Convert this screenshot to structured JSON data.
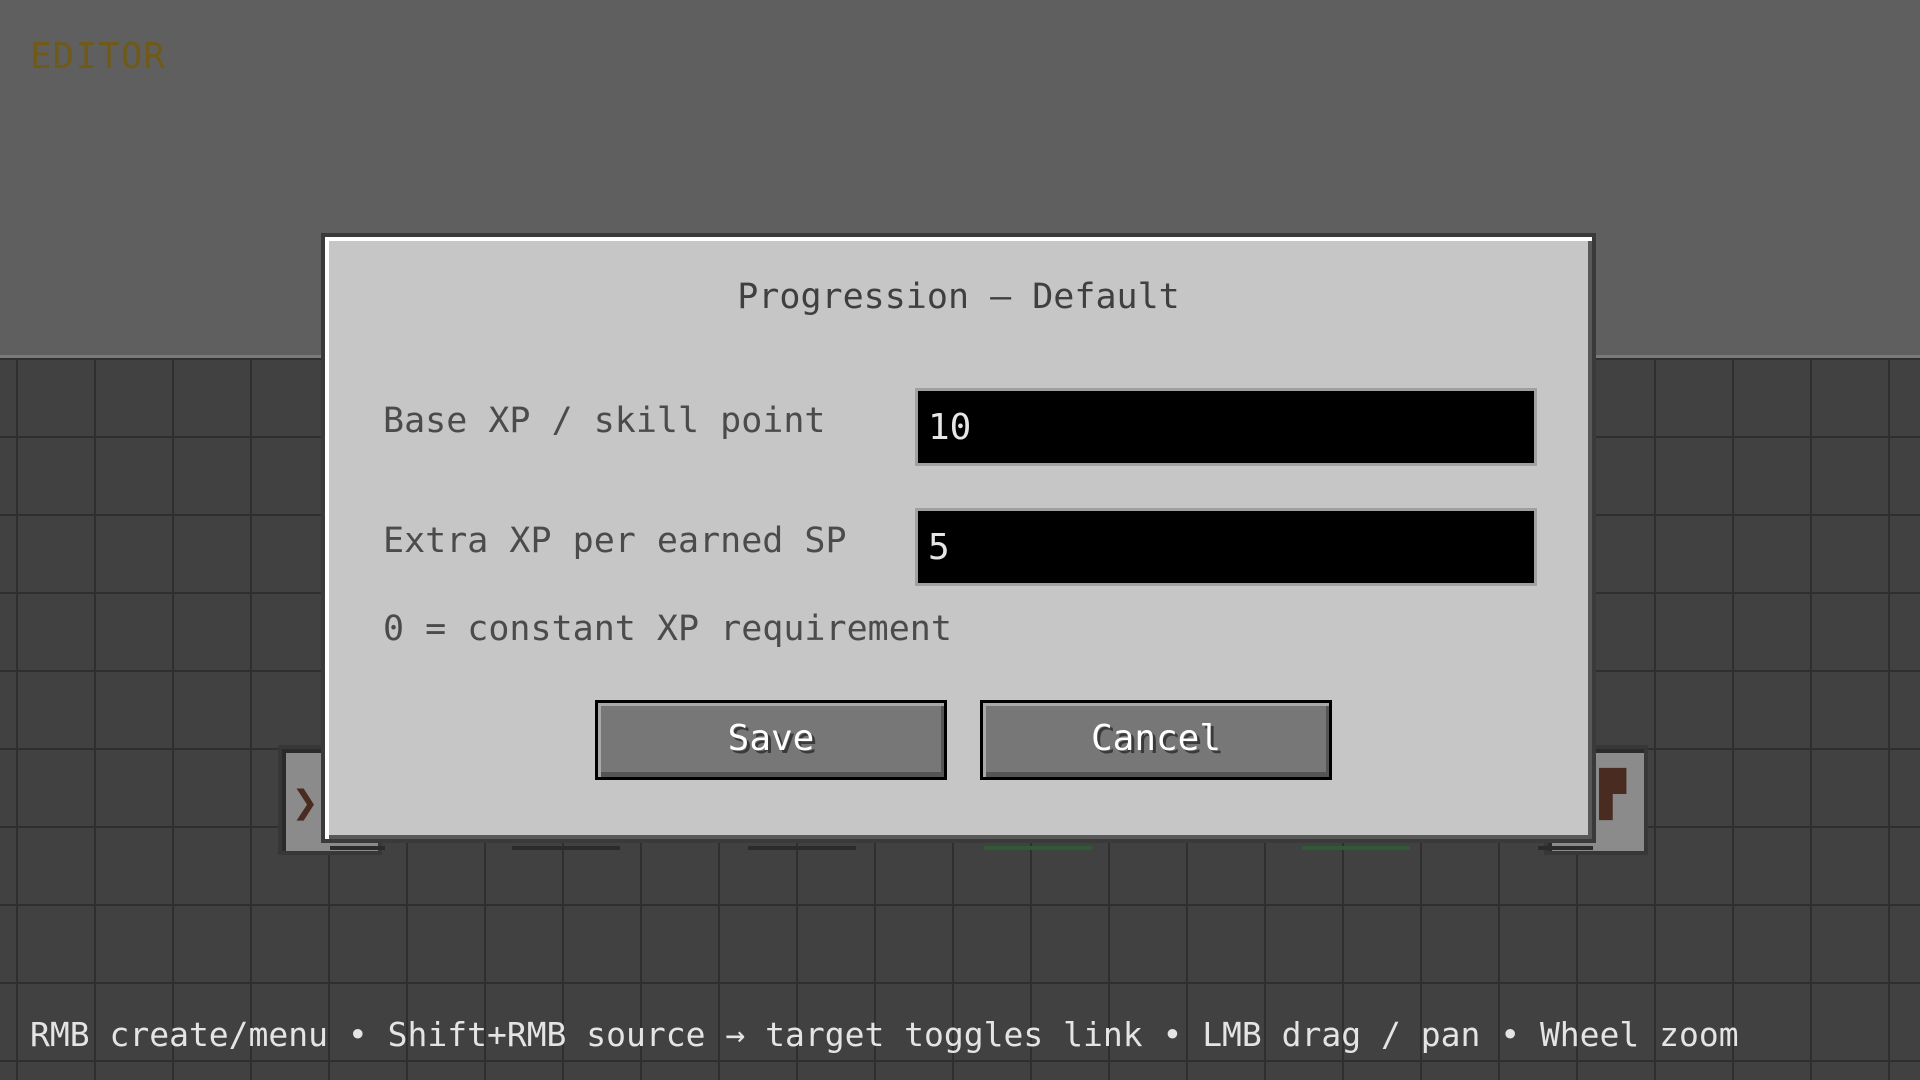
{
  "header": {
    "mode_label": "EDITOR"
  },
  "dialog": {
    "title": "Progression — Default",
    "fields": [
      {
        "label": "Base XP / skill point",
        "value": "10"
      },
      {
        "label": "Extra XP per earned SP",
        "value": "5"
      }
    ],
    "hint": "0 = constant XP requirement",
    "save_label": "Save",
    "cancel_label": "Cancel"
  },
  "footer": {
    "help_text": "RMB create/menu • Shift+RMB source → target toggles link • LMB drag / pan • Wheel zoom"
  },
  "colors": {
    "accent_label": "#6f5a17",
    "dialog_bg": "#c6c6c6",
    "button_bg": "#777777",
    "input_bg": "#000000"
  }
}
